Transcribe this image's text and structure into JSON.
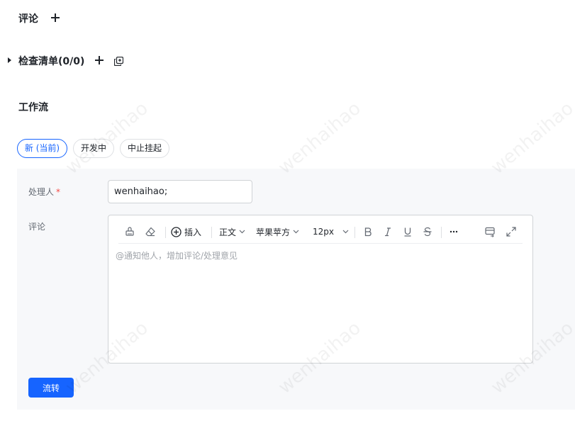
{
  "sections": {
    "comments_title": "评论",
    "checklist_title": "检查清单(0/0)",
    "workflow_title": "工作流"
  },
  "workflow": {
    "states": [
      {
        "label": "新 (当前)",
        "active": true
      },
      {
        "label": "开发中",
        "active": false
      },
      {
        "label": "中止挂起",
        "active": false
      }
    ]
  },
  "form": {
    "assignee_label": "处理人",
    "required_mark": "*",
    "assignee_value": "wenhaihao;",
    "comment_label": "评论",
    "editor_placeholder": "@通知他人，增加评论/处理意见",
    "submit_label": "流转"
  },
  "toolbar": {
    "insert_label": "插入",
    "paragraph_style": "正文",
    "font_family": "苹果苹方",
    "font_size": "12px"
  },
  "watermark": {
    "text": "wenhaihao"
  },
  "colors": {
    "accent": "#1664ff",
    "required": "#f54a45",
    "panel_bg": "#f7f8fa"
  }
}
